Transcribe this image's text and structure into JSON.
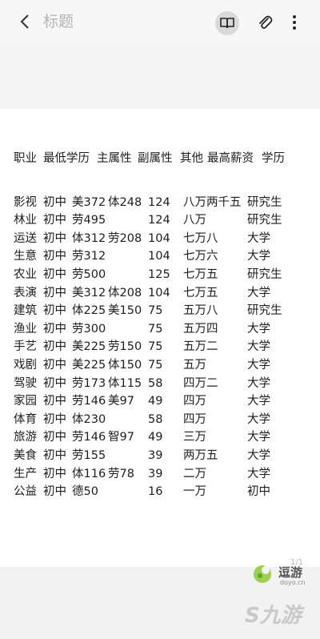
{
  "toolbar": {
    "title": "标题",
    "icons": [
      "back-arrow-icon",
      "reader-mode-icon",
      "paperclip-icon",
      "more-options-icon"
    ]
  },
  "table": {
    "headers": [
      "职业",
      "最低学历",
      "主属性",
      "副属性",
      "其他",
      "最高薪资",
      "学历"
    ],
    "rows": [
      [
        "影视",
        "初中",
        "美372",
        "体248",
        "124",
        "八万两千五",
        "研究生"
      ],
      [
        "林业",
        "初中",
        "劳495",
        "",
        "124",
        "八万",
        "研究生"
      ],
      [
        "运送",
        "初中",
        "体312",
        "劳208",
        "104",
        "七万八",
        "大学"
      ],
      [
        "生意",
        "初中",
        "劳312",
        "",
        "104",
        "七万六",
        "大学"
      ],
      [
        "农业",
        "初中",
        "劳500",
        "",
        "125",
        "七万五",
        "研究生"
      ],
      [
        "表演",
        "初中",
        "美312",
        "体208",
        "104",
        "七万五",
        "大学"
      ],
      [
        "建筑",
        "初中",
        "体225",
        "美150",
        "75",
        "五万八",
        "研究生"
      ],
      [
        "渔业",
        "初中",
        "劳300",
        "",
        "75",
        "五万四",
        "大学"
      ],
      [
        "手艺",
        "初中",
        "美225",
        "劳150",
        "75",
        "五万二",
        "大学"
      ],
      [
        "戏剧",
        "初中",
        "美225",
        "体150",
        "75",
        "五万",
        "大学"
      ],
      [
        "驾驶",
        "初中",
        "劳173",
        "体115",
        "58",
        "四万二",
        "大学"
      ],
      [
        "家园",
        "初中",
        "劳146",
        "美97",
        "49",
        "四万",
        "大学"
      ],
      [
        "体育",
        "初中",
        "体230",
        "",
        "58",
        "四万",
        "大学"
      ],
      [
        "旅游",
        "初中",
        "劳146",
        "智97",
        "49",
        "三万",
        "大学"
      ],
      [
        "美食",
        "初中",
        "劳155",
        "",
        "39",
        "两万五",
        "大学"
      ],
      [
        "生产",
        "初中",
        "体116",
        "劳78",
        "39",
        "二万",
        "大学"
      ],
      [
        "公益",
        "初中",
        "德50",
        "",
        "16",
        "一万",
        "初中"
      ]
    ]
  },
  "page_indicator": "1/1",
  "watermark": {
    "name": "逗游",
    "url": "doyo.cn",
    "brand2": "九游"
  }
}
